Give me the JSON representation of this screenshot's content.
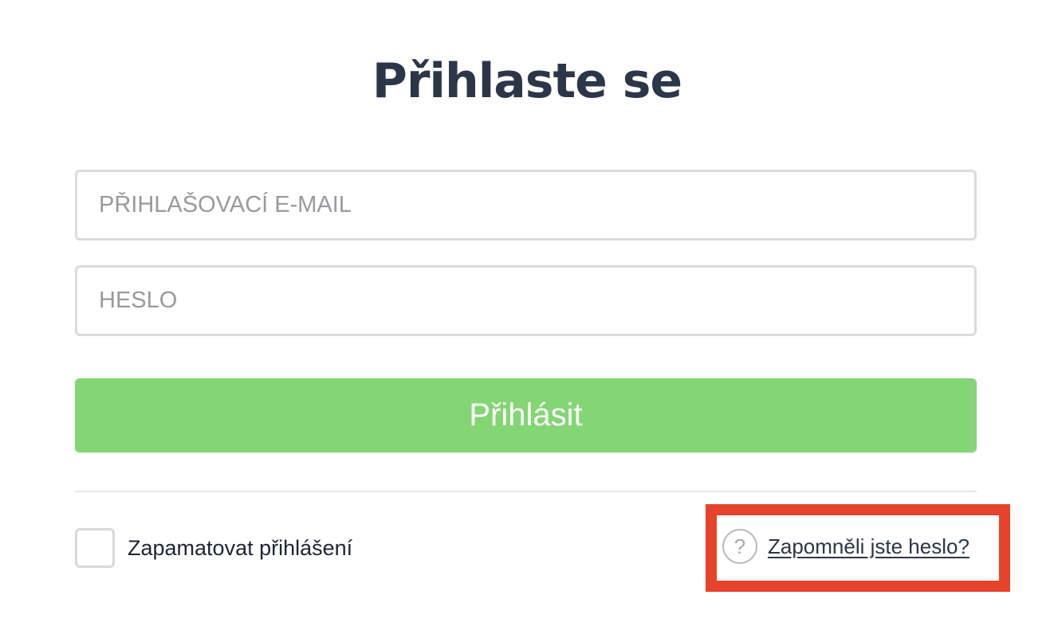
{
  "login": {
    "title": "Přihlaste se",
    "email_placeholder": "PŘIHLAŠOVACÍ E-MAIL",
    "password_placeholder": "HESLO",
    "submit_label": "Přihlásit",
    "remember_label": "Zapamatovat přihlášení",
    "forgot_label": "Zapomněli jste heslo?",
    "help_icon_glyph": "?",
    "remember_checked": false
  },
  "colors": {
    "title": "#2c3649",
    "submit_bg": "#83d673",
    "highlight_border": "#e5432b"
  },
  "icons": {
    "help": "question-circle-icon"
  }
}
